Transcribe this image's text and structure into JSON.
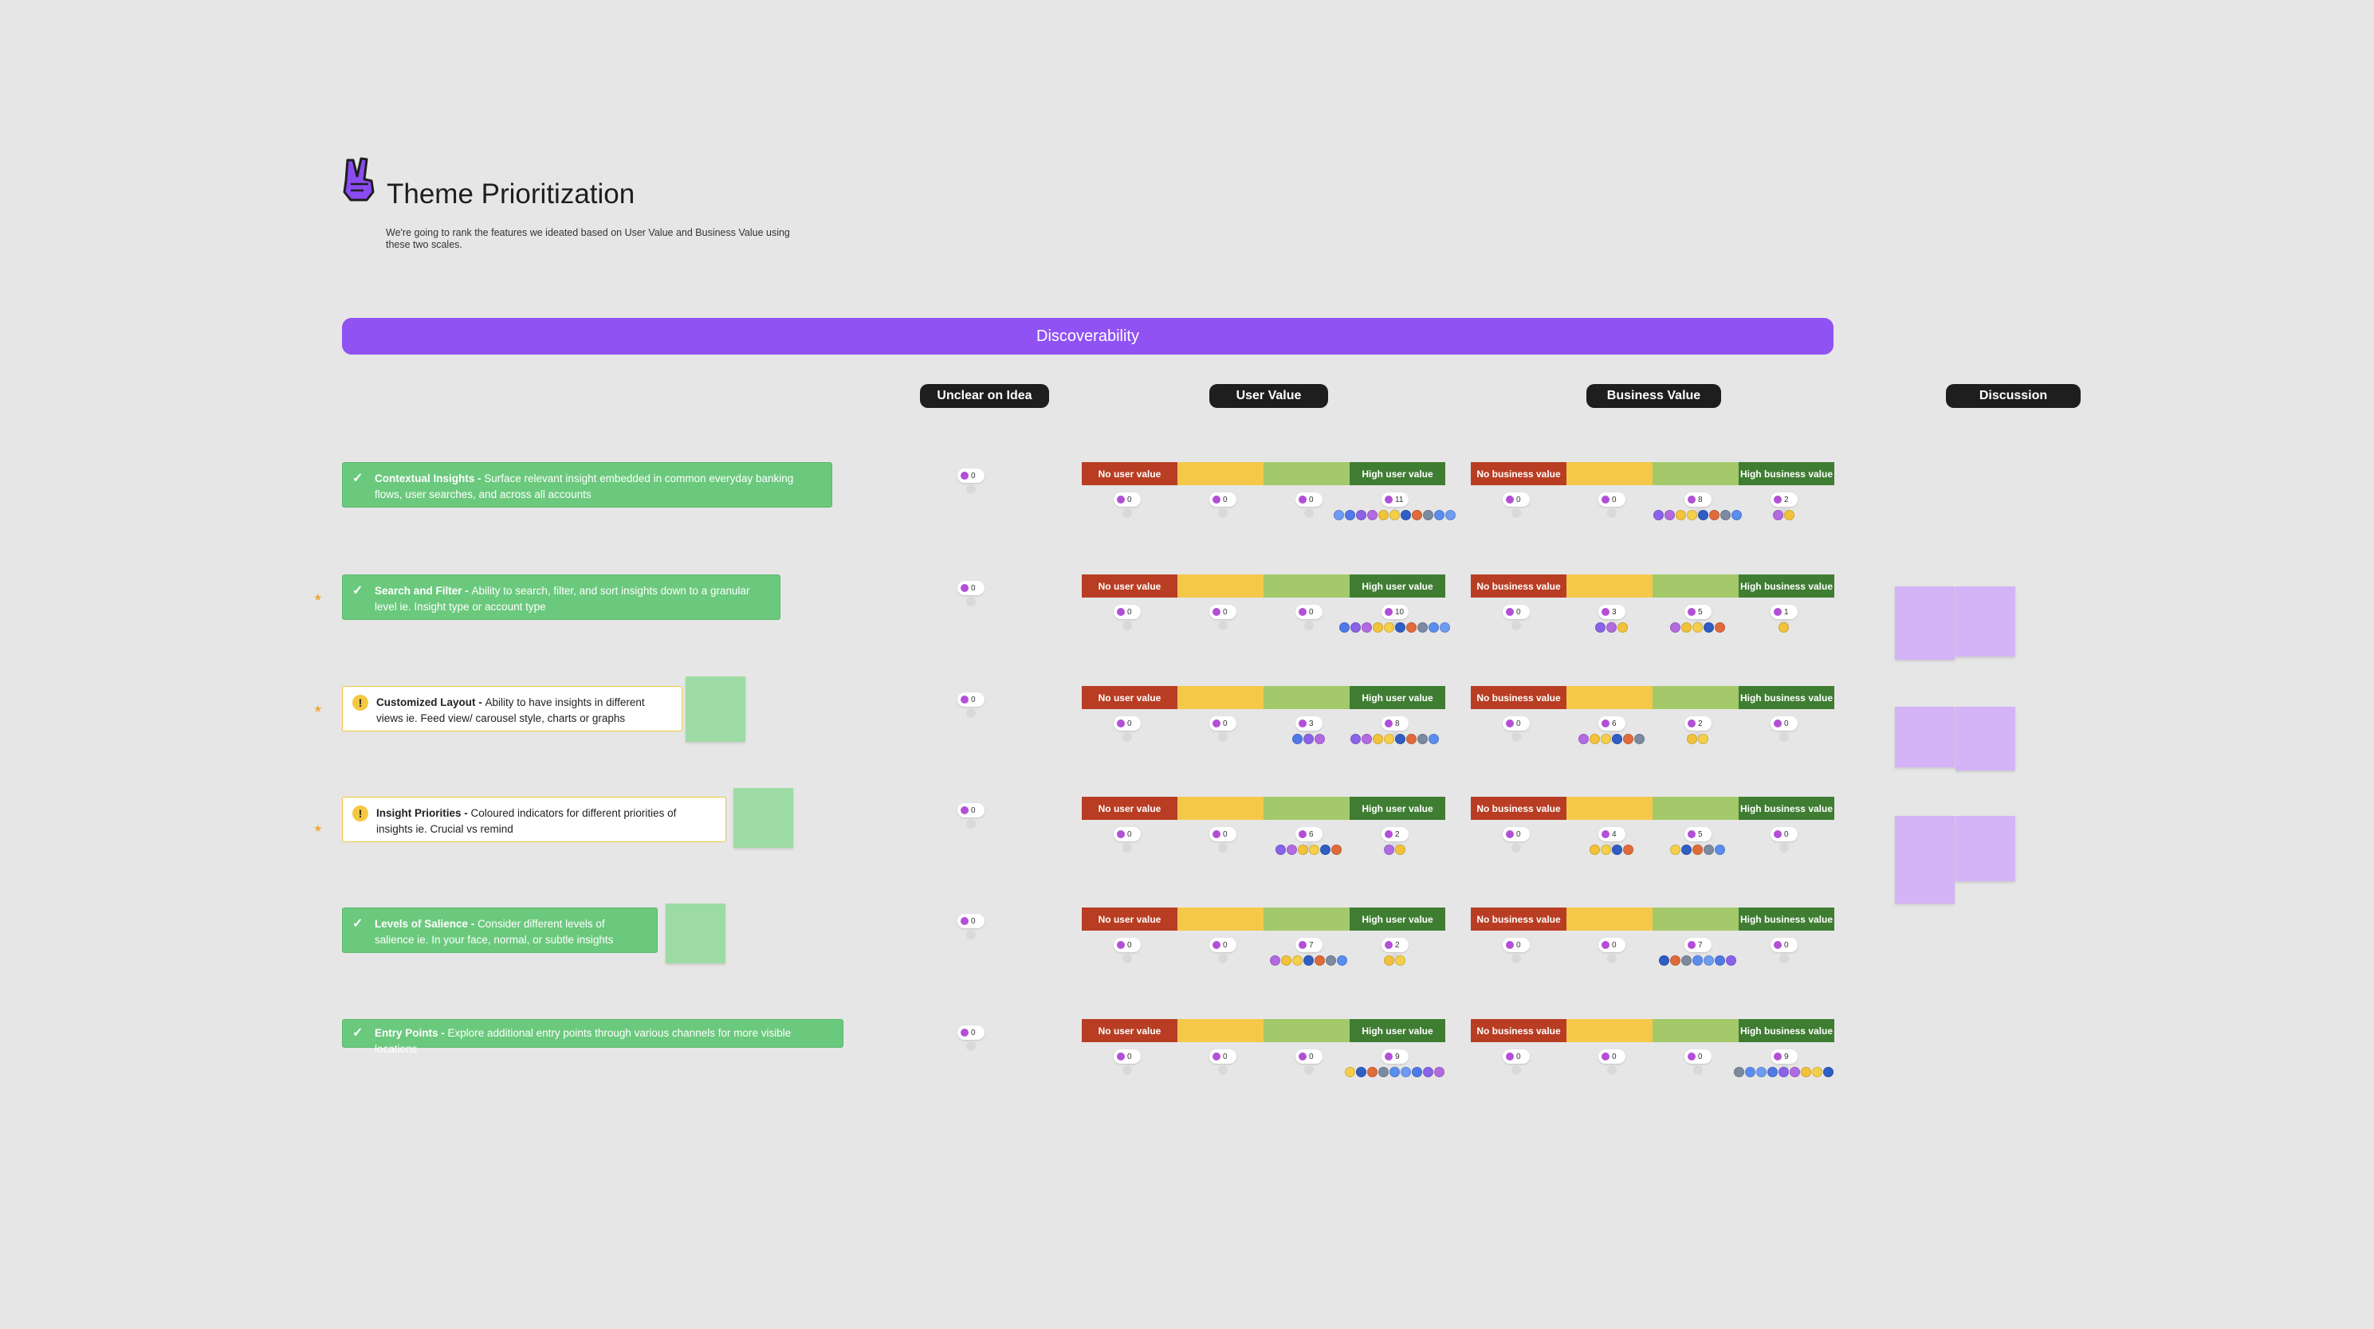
{
  "header": {
    "title": "Theme Prioritization",
    "subtitle": "We're going to rank the features we ideated based on User Value and Business Value using these two scales."
  },
  "banner": {
    "label": "Discoverability"
  },
  "columns": {
    "unclear": "Unclear on Idea",
    "user_value": "User Value",
    "business_value": "Business Value",
    "discussion": "Discussion"
  },
  "scale_labels": {
    "no_user": "No user value",
    "high_user": "High user value",
    "no_business": "No business value",
    "high_business": "High business value"
  },
  "colors": {
    "banner": "#9052f2",
    "red": "#b83d23",
    "yellow": "#f5c84a",
    "light_green": "#a3c96a",
    "dark_green": "#3f7d32",
    "card_green": "#6bc97d",
    "card_warning_border": "#f2c53d"
  },
  "features": [
    {
      "name": "Contextual Insights - ",
      "desc": "Surface relevant insight embedded in common everyday banking flows, user searches, and across all accounts",
      "status": "approved",
      "starred": false,
      "unclear": "0",
      "user_votes": [
        "0",
        "0",
        "0",
        "11"
      ],
      "business_votes": [
        "0",
        "0",
        "8",
        "2"
      ]
    },
    {
      "name": "Search and Filter - ",
      "desc": "Ability to search, filter, and sort insights down to a granular level ie. Insight type or account type",
      "status": "approved",
      "starred": true,
      "unclear": "0",
      "user_votes": [
        "0",
        "0",
        "0",
        "10"
      ],
      "business_votes": [
        "0",
        "3",
        "5",
        "1"
      ]
    },
    {
      "name": "Customized Layout - ",
      "desc": "Ability to have insights in different views ie. Feed view/ carousel style, charts or graphs",
      "status": "warning",
      "starred": true,
      "unclear": "0",
      "user_votes": [
        "0",
        "0",
        "3",
        "8"
      ],
      "business_votes": [
        "0",
        "6",
        "2",
        "0"
      ]
    },
    {
      "name": "Insight Priorities - ",
      "desc": "Coloured indicators for different priorities of insights ie. Crucial vs remind",
      "status": "warning",
      "starred": true,
      "unclear": "0",
      "user_votes": [
        "0",
        "0",
        "6",
        "2"
      ],
      "business_votes": [
        "0",
        "4",
        "5",
        "0"
      ]
    },
    {
      "name": "Levels of Salience - ",
      "desc": "Consider different levels of salience ie. In your face, normal, or subtle insights",
      "status": "approved",
      "starred": false,
      "unclear": "0",
      "user_votes": [
        "0",
        "0",
        "7",
        "2"
      ],
      "business_votes": [
        "0",
        "0",
        "7",
        "0"
      ]
    },
    {
      "name": "Entry Points - ",
      "desc": "Explore additional entry points through various channels for more visible locations",
      "status": "approved",
      "starred": false,
      "unclear": "0",
      "user_votes": [
        "0",
        "0",
        "0",
        "9"
      ],
      "business_votes": [
        "0",
        "0",
        "0",
        "9"
      ]
    }
  ]
}
